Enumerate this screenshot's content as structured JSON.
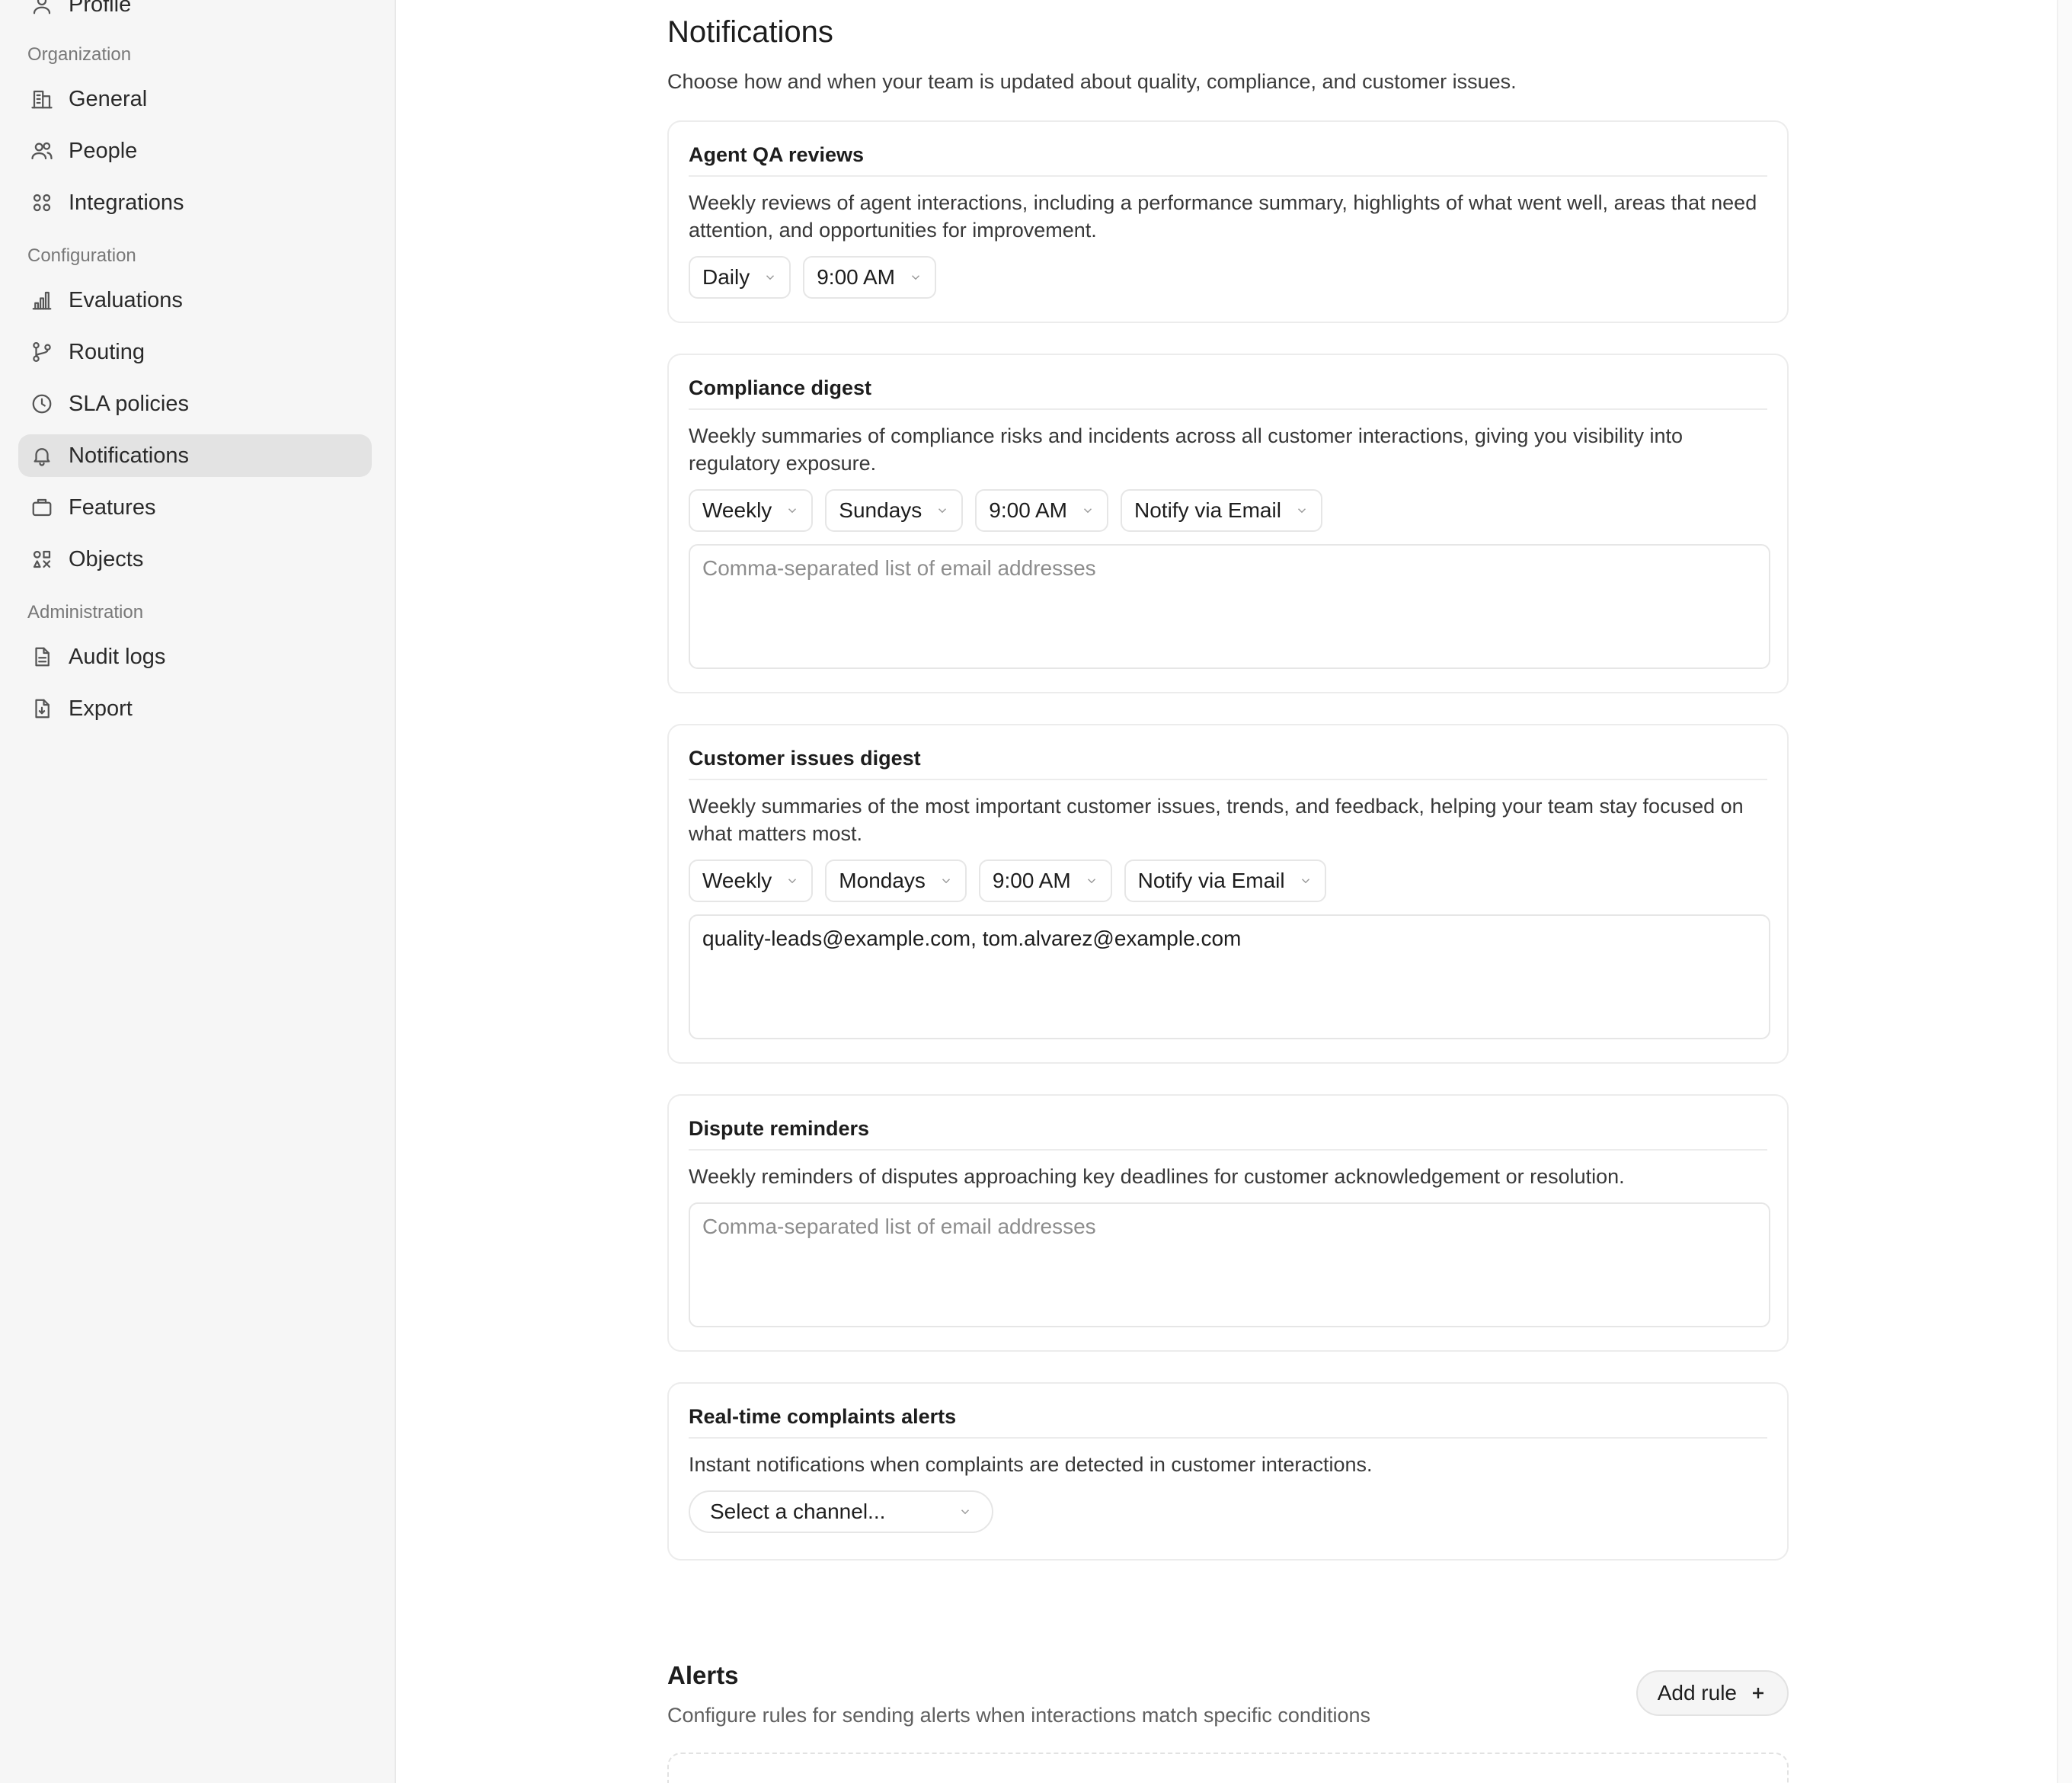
{
  "sidebar": {
    "top_item": "Profile",
    "sections": {
      "organization": "Organization",
      "configuration": "Configuration",
      "administration": "Administration"
    },
    "items": {
      "general": "General",
      "people": "People",
      "integrations": "Integrations",
      "evaluations": "Evaluations",
      "routing": "Routing",
      "sla": "SLA policies",
      "notifications": "Notifications",
      "features": "Features",
      "objects": "Objects",
      "audit": "Audit logs",
      "export": "Export"
    },
    "active_item": "Notifications"
  },
  "main": {
    "title": "Notifications",
    "description": "Choose how and when your team is updated about quality, compliance, and customer issues.",
    "cards": {
      "agent_qa": {
        "title": "Agent QA reviews",
        "description": "Weekly reviews of agent interactions, including a performance summary, highlights of what went well, areas that need attention, and opportunities for improvement.",
        "frequency": "Daily",
        "time": "9:00 AM"
      },
      "compliance": {
        "title": "Compliance digest",
        "description": "Weekly summaries of compliance risks and incidents across all customer interactions, giving you visibility into regulatory exposure.",
        "frequency": "Weekly",
        "day": "Sundays",
        "time": "9:00 AM",
        "channel": "Notify via Email",
        "emails_placeholder": "Comma-separated list of email addresses"
      },
      "customer_issues": {
        "title": "Customer issues digest",
        "description": "Weekly summaries of the most important customer issues, trends, and feedback, helping your team stay focused on what matters most.",
        "frequency": "Weekly",
        "day": "Mondays",
        "time": "9:00 AM",
        "channel": "Notify via Email",
        "emails_value": "quality-leads@example.com, tom.alvarez@example.com"
      },
      "dispute": {
        "title": "Dispute reminders",
        "description": "Weekly reminders of disputes approaching key deadlines for customer acknowledgement or resolution.",
        "emails_placeholder": "Comma-separated list of email addresses"
      },
      "complaints": {
        "title": "Real-time complaints alerts",
        "description": "Instant notifications when complaints are detected in customer interactions.",
        "channel_placeholder": "Select a channel..."
      }
    },
    "alerts": {
      "title": "Alerts",
      "description": "Configure rules for sending alerts when interactions match specific conditions",
      "add_rule_label": "Add rule"
    }
  },
  "icons": {
    "profile": "user-icon",
    "general": "building-icon",
    "people": "users-icon",
    "integrations": "grid-icon",
    "evaluations": "bar-chart-icon",
    "routing": "git-branch-icon",
    "sla": "clock-icon",
    "notifications": "bell-icon",
    "features": "briefcase-icon",
    "objects": "shapes-icon",
    "audit": "file-text-icon",
    "export": "file-export-icon",
    "dropdown": "chevron-down-icon",
    "add": "plus-icon"
  }
}
